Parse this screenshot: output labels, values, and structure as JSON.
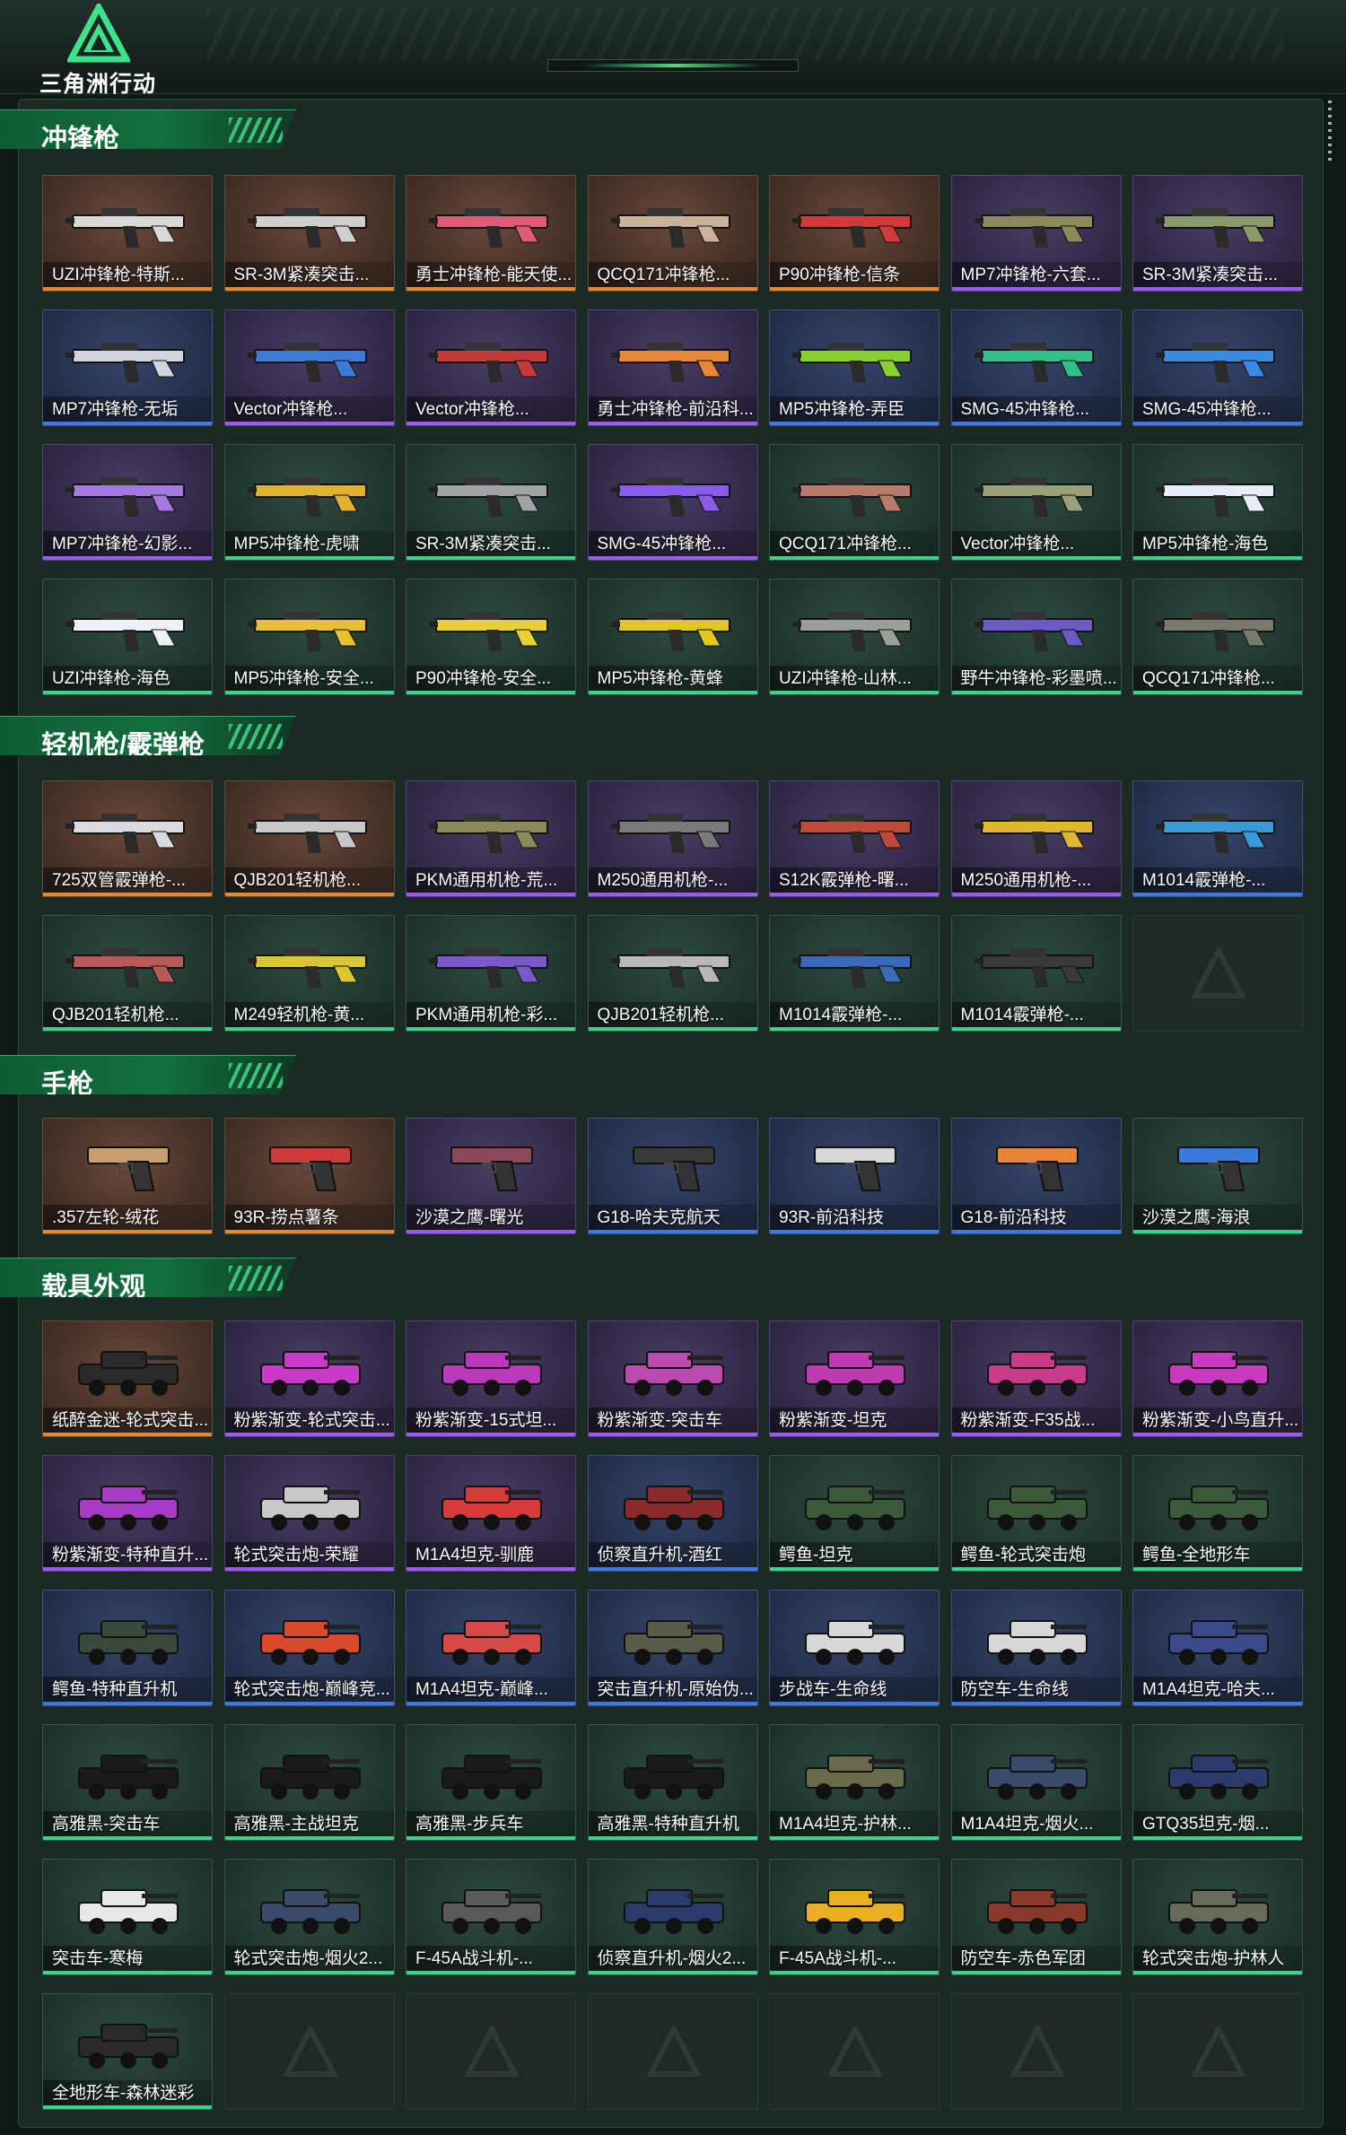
{
  "app": {
    "logo_text": "三角洲行动",
    "logo_icon": "delta-triangle-logo"
  },
  "colors": {
    "gold": "#e08a38",
    "purple": "#9a5cf0",
    "blue": "#3f78e6",
    "green": "#3fd18a"
  },
  "sections": [
    {
      "title": "冲锋枪",
      "icon": "gun-icon",
      "items": [
        {
          "name": "UZI冲锋枪-特斯...",
          "rarity": "gold",
          "color": "#d9d9d9"
        },
        {
          "name": "SR-3M紧凑突击...",
          "rarity": "gold",
          "color": "#cfcfcf"
        },
        {
          "name": "勇士冲锋枪-能天使...",
          "rarity": "gold",
          "color": "#e25a7a"
        },
        {
          "name": "QCQ171冲锋枪...",
          "rarity": "gold",
          "color": "#c9b39a"
        },
        {
          "name": "P90冲锋枪-信条",
          "rarity": "gold",
          "color": "#d23a3a"
        },
        {
          "name": "MP7冲锋枪-六套...",
          "rarity": "purple",
          "color": "#8c8a5a"
        },
        {
          "name": "SR-3M紧凑突击...",
          "rarity": "purple",
          "color": "#8a9a6a"
        },
        {
          "name": "MP7冲锋枪-无垢",
          "rarity": "blue",
          "color": "#d0d4dc"
        },
        {
          "name": "Vector冲锋枪...",
          "rarity": "purple",
          "color": "#3c7bd8"
        },
        {
          "name": "Vector冲锋枪...",
          "rarity": "purple",
          "color": "#c23a3a"
        },
        {
          "name": "勇士冲锋枪-前沿科...",
          "rarity": "purple",
          "color": "#e8873a"
        },
        {
          "name": "MP5冲锋枪-弄臣",
          "rarity": "blue",
          "color": "#8ad030"
        },
        {
          "name": "SMG-45冲锋枪...",
          "rarity": "blue",
          "color": "#2fbf8a"
        },
        {
          "name": "SMG-45冲锋枪...",
          "rarity": "blue",
          "color": "#3a8ae0"
        },
        {
          "name": "MP7冲锋枪-幻影...",
          "rarity": "purple",
          "color": "#a47ae0"
        },
        {
          "name": "MP5冲锋枪-虎啸",
          "rarity": "green",
          "color": "#e0b030"
        },
        {
          "name": "SR-3M紧凑突击...",
          "rarity": "green",
          "color": "#a0a4a8"
        },
        {
          "name": "SMG-45冲锋枪...",
          "rarity": "purple",
          "color": "#8a5ae8"
        },
        {
          "name": "QCQ171冲锋枪...",
          "rarity": "green",
          "color": "#b87a6a"
        },
        {
          "name": "Vector冲锋枪...",
          "rarity": "green",
          "color": "#9aa07a"
        },
        {
          "name": "MP5冲锋枪-海色",
          "rarity": "green",
          "color": "#e8eef8"
        },
        {
          "name": "UZI冲锋枪-海色",
          "rarity": "green",
          "color": "#eef2f8"
        },
        {
          "name": "MP5冲锋枪-安全...",
          "rarity": "green",
          "color": "#e8c030"
        },
        {
          "name": "P90冲锋枪-安全...",
          "rarity": "green",
          "color": "#e8d030"
        },
        {
          "name": "MP5冲锋枪-黄蜂",
          "rarity": "green",
          "color": "#e0c820"
        },
        {
          "name": "UZI冲锋枪-山林...",
          "rarity": "green",
          "color": "#9aa098"
        },
        {
          "name": "野牛冲锋枪-彩墨喷...",
          "rarity": "green",
          "color": "#6a5ac8"
        },
        {
          "name": "QCQ171冲锋枪...",
          "rarity": "green",
          "color": "#7a7a6a"
        }
      ]
    },
    {
      "title": "轻机枪/霰弹枪",
      "icon": "gun-icon",
      "items": [
        {
          "name": "725双管霰弹枪-...",
          "rarity": "gold",
          "color": "#d8dce0"
        },
        {
          "name": "QJB201轻机枪...",
          "rarity": "gold",
          "color": "#c8c8c8"
        },
        {
          "name": "PKM通用机枪-荒...",
          "rarity": "purple",
          "color": "#8a8a5a"
        },
        {
          "name": "M250通用机枪-...",
          "rarity": "purple",
          "color": "#7a7a7a"
        },
        {
          "name": "S12K霰弹枪-曙...",
          "rarity": "purple",
          "color": "#c04a3a"
        },
        {
          "name": "M250通用机枪-...",
          "rarity": "purple",
          "color": "#e0b830"
        },
        {
          "name": "M1014霰弹枪-...",
          "rarity": "blue",
          "color": "#3a9ad8"
        },
        {
          "name": "QJB201轻机枪...",
          "rarity": "green",
          "color": "#b85a5a"
        },
        {
          "name": "M249轻机枪-黄...",
          "rarity": "green",
          "color": "#d8c830"
        },
        {
          "name": "PKM通用机枪-彩...",
          "rarity": "green",
          "color": "#7a5ac8"
        },
        {
          "name": "QJB201轻机枪...",
          "rarity": "green",
          "color": "#b8b8b8"
        },
        {
          "name": "M1014霰弹枪-...",
          "rarity": "green",
          "color": "#3a6ab8"
        },
        {
          "name": "M1014霰弹枪-...",
          "rarity": "green",
          "color": "#3a3a3a"
        },
        {
          "name": "",
          "rarity": "empty",
          "color": ""
        }
      ]
    },
    {
      "title": "手枪",
      "icon": "pistol-icon",
      "items": [
        {
          "name": ".357左轮-绒花",
          "rarity": "gold",
          "color": "#c8a070"
        },
        {
          "name": "93R-捞点薯条",
          "rarity": "gold",
          "color": "#d03a3a"
        },
        {
          "name": "沙漠之鹰-曙光",
          "rarity": "purple",
          "color": "#8a4a5a"
        },
        {
          "name": "G18-哈夫克航天",
          "rarity": "blue",
          "color": "#3a3a3a"
        },
        {
          "name": "93R-前沿科技",
          "rarity": "blue",
          "color": "#d8d8d8"
        },
        {
          "name": "G18-前沿科技",
          "rarity": "blue",
          "color": "#e8843a"
        },
        {
          "name": "沙漠之鹰-海浪",
          "rarity": "green",
          "color": "#3a7ad8"
        }
      ]
    },
    {
      "title": "载具外观",
      "icon": "vehicle-icon",
      "items": [
        {
          "name": "纸醉金迷-轮式突击...",
          "rarity": "gold",
          "color": "#2a2a2a"
        },
        {
          "name": "粉紫渐变-轮式突击...",
          "rarity": "purple",
          "color": "#c83ac8"
        },
        {
          "name": "粉紫渐变-15式坦...",
          "rarity": "purple",
          "color": "#b83ab8"
        },
        {
          "name": "粉紫渐变-突击车",
          "rarity": "purple",
          "color": "#b84ab0"
        },
        {
          "name": "粉紫渐变-坦克",
          "rarity": "purple",
          "color": "#c03ab0"
        },
        {
          "name": "粉紫渐变-F35战...",
          "rarity": "purple",
          "color": "#c83a8a"
        },
        {
          "name": "粉紫渐变-小鸟直升...",
          "rarity": "purple",
          "color": "#c83ac0"
        },
        {
          "name": "粉紫渐变-特种直升...",
          "rarity": "purple",
          "color": "#a83ac8"
        },
        {
          "name": "轮式突击炮-荣耀",
          "rarity": "purple",
          "color": "#c8c8c8"
        },
        {
          "name": "M1A4坦克-驯鹿",
          "rarity": "purple",
          "color": "#d83a3a"
        },
        {
          "name": "侦察直升机-酒红",
          "rarity": "blue",
          "color": "#8a2a2a"
        },
        {
          "name": "鳄鱼-坦克",
          "rarity": "green",
          "color": "#3a5a3a"
        },
        {
          "name": "鳄鱼-轮式突击炮",
          "rarity": "green",
          "color": "#3a5a3a"
        },
        {
          "name": "鳄鱼-全地形车",
          "rarity": "green",
          "color": "#3a5a3a"
        },
        {
          "name": "鳄鱼-特种直升机",
          "rarity": "blue",
          "color": "#3a4a3a"
        },
        {
          "name": "轮式突击炮-巅峰竞...",
          "rarity": "blue",
          "color": "#d84a2a"
        },
        {
          "name": "M1A4坦克-巅峰...",
          "rarity": "blue",
          "color": "#d84a4a"
        },
        {
          "name": "突击直升机-原始伪...",
          "rarity": "blue",
          "color": "#5a5a4a"
        },
        {
          "name": "步战车-生命线",
          "rarity": "blue",
          "color": "#d8d8d8"
        },
        {
          "name": "防空车-生命线",
          "rarity": "blue",
          "color": "#d8d8d8"
        },
        {
          "name": "M1A4坦克-哈夫...",
          "rarity": "blue",
          "color": "#3a4a8a"
        },
        {
          "name": "高雅黑-突击车",
          "rarity": "green",
          "color": "#1a1a1a"
        },
        {
          "name": "高雅黑-主战坦克",
          "rarity": "green",
          "color": "#1a1a1a"
        },
        {
          "name": "高雅黑-步兵车",
          "rarity": "green",
          "color": "#1a1a1a"
        },
        {
          "name": "高雅黑-特种直升机",
          "rarity": "green",
          "color": "#1a1a1a"
        },
        {
          "name": "M1A4坦克-护林...",
          "rarity": "green",
          "color": "#6a6a4a"
        },
        {
          "name": "M1A4坦克-烟火...",
          "rarity": "green",
          "color": "#3a4a6a"
        },
        {
          "name": "GTQ35坦克-烟...",
          "rarity": "green",
          "color": "#2a3a6a"
        },
        {
          "name": "突击车-寒梅",
          "rarity": "green",
          "color": "#e8e8e8"
        },
        {
          "name": "轮式突击炮-烟火2...",
          "rarity": "green",
          "color": "#3a4a6a"
        },
        {
          "name": "F-45A战斗机-...",
          "rarity": "green",
          "color": "#5a5a5a"
        },
        {
          "name": "侦察直升机-烟火2...",
          "rarity": "green",
          "color": "#2a3a6a"
        },
        {
          "name": "F-45A战斗机-...",
          "rarity": "green",
          "color": "#e8b020"
        },
        {
          "name": "防空车-赤色军团",
          "rarity": "green",
          "color": "#8a3a2a"
        },
        {
          "name": "轮式突击炮-护林人",
          "rarity": "green",
          "color": "#6a6a5a"
        },
        {
          "name": "全地形车-森林迷彩",
          "rarity": "green",
          "color": "#2a2a2a"
        },
        {
          "name": "",
          "rarity": "empty",
          "color": ""
        },
        {
          "name": "",
          "rarity": "empty",
          "color": ""
        },
        {
          "name": "",
          "rarity": "empty",
          "color": ""
        },
        {
          "name": "",
          "rarity": "empty",
          "color": ""
        },
        {
          "name": "",
          "rarity": "empty",
          "color": ""
        },
        {
          "name": "",
          "rarity": "empty",
          "color": ""
        }
      ]
    }
  ]
}
